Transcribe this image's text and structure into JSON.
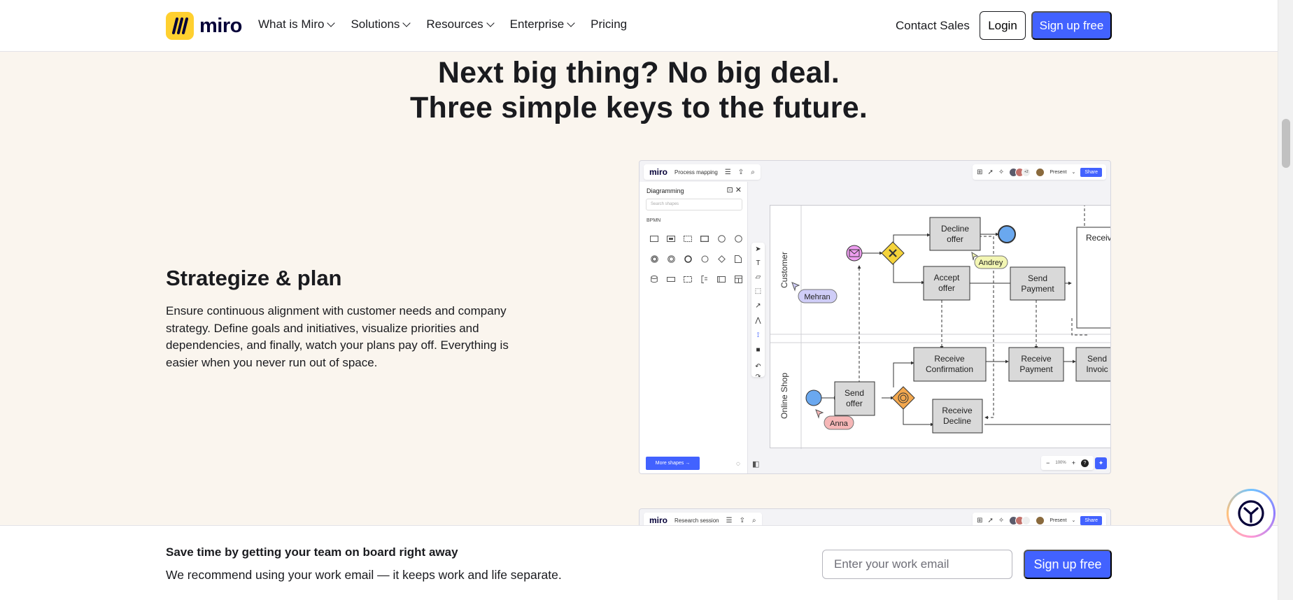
{
  "nav": {
    "logo_text": "miro",
    "menu": [
      {
        "label": "What is Miro"
      },
      {
        "label": "Solutions"
      },
      {
        "label": "Resources"
      },
      {
        "label": "Enterprise"
      }
    ],
    "pricing": "Pricing",
    "contact_sales": "Contact Sales",
    "login": "Login",
    "signup": "Sign up free"
  },
  "hero": {
    "line1": "Next big thing? No big deal.",
    "line2": "Three simple keys to the future."
  },
  "section": {
    "title": "Strategize & plan",
    "description": "Ensure continuous alignment with customer needs and company strategy. Define goals and initiatives, visualize priorities and dependencies, and finally, watch your plans pay off. Everything is easier when you never run out of space."
  },
  "screenshot": {
    "logo": "miro",
    "board_name": "Process mapping",
    "avatar_count": "+2",
    "present": "Present",
    "share": "Share",
    "panel_title": "Diagramming",
    "search_placeholder": "Search shapes",
    "category": "BPMN",
    "more_shapes": "More shapes →",
    "zoom": "100%",
    "lanes": [
      "Customer",
      "Online Shop"
    ],
    "nodes": {
      "decline_offer": [
        "Decline",
        "offer"
      ],
      "accept_offer": [
        "Accept",
        "offer"
      ],
      "send_payment": [
        "Send",
        "Payment"
      ],
      "receive_partial": "Receiv",
      "send_offer": [
        "Send",
        "offer"
      ],
      "receive_confirmation": [
        "Receive",
        "Confirmation"
      ],
      "receive_payment": [
        "Receive",
        "Payment"
      ],
      "send_invoice": [
        "Send",
        "Invoic"
      ],
      "receive_decline": [
        "Receive",
        "Decline"
      ]
    },
    "cursors": [
      "Andrey",
      "Mehran",
      "Anna"
    ],
    "colors": {
      "accent": "#4262ff",
      "node_fill": "#d9d9d9",
      "event_blue": "#6aa8ef",
      "event_purple": "#a9a4f2",
      "message_pink": "#ee9ef0",
      "gateway_yellow": "#f5d33a",
      "gateway_orange": "#f3a84f"
    }
  },
  "screenshot2": {
    "logo": "miro",
    "board_name": "Research session",
    "present": "Present",
    "share": "Share"
  },
  "banner": {
    "title": "Save time by getting your team on board right away",
    "subtitle": "We recommend using your work email — it keeps work and life separate.",
    "email_placeholder": "Enter your work email",
    "signup": "Sign up free"
  },
  "colors": {
    "brand_yellow": "#ffd02f",
    "accent_blue": "#4262ff",
    "page_bg": "#faf5ee"
  }
}
